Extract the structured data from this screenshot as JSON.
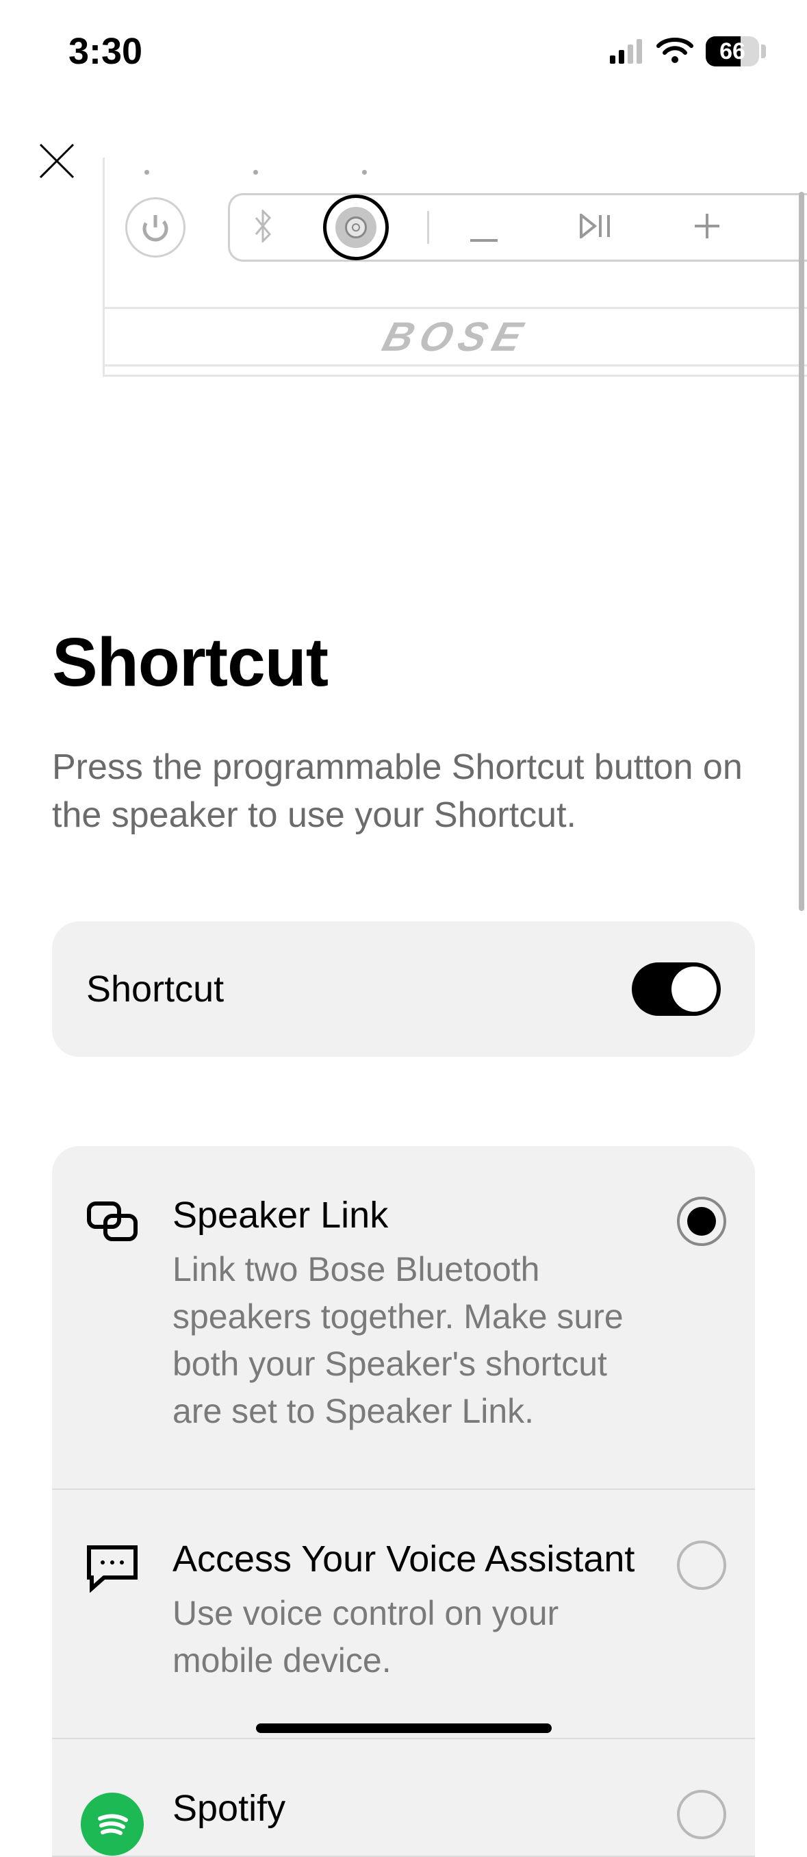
{
  "status": {
    "time": "3:30",
    "battery_pct": "66"
  },
  "brand": "BOSE",
  "heading": "Shortcut",
  "subtitle": "Press the programmable Shortcut button on the speaker to use your Shortcut.",
  "toggle": {
    "label": "Shortcut",
    "on": true
  },
  "options": [
    {
      "title": "Speaker Link",
      "desc": "Link two Bose Bluetooth speakers together. Make sure both your Speaker's shortcut are set to Speaker Link.",
      "selected": true
    },
    {
      "title": "Access Your Voice Assistant",
      "desc": "Use voice control on your mobile device.",
      "selected": false
    },
    {
      "title": "Spotify",
      "desc": "",
      "selected": false
    }
  ]
}
